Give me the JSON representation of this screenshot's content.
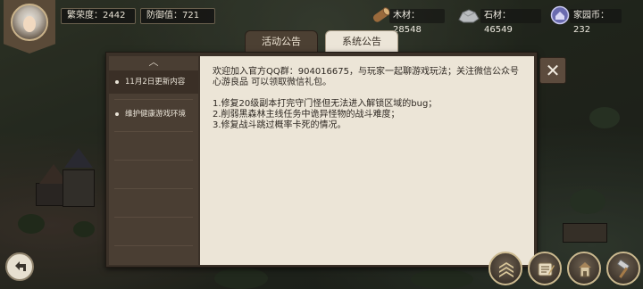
{
  "hud": {
    "prosperity": "繁荣度：2442",
    "defense": "防御值：721",
    "wood": "木材：28548",
    "stone": "石材：46549",
    "home_coin": "家园币：232"
  },
  "dialog": {
    "tabs": [
      {
        "label": "活动公告"
      },
      {
        "label": "系统公告"
      }
    ],
    "menu": [
      {
        "label": "11月2日更新内容"
      },
      {
        "label": "维护健康游戏环境"
      }
    ],
    "scroll_up_glyph": "︿",
    "close_glyph": "✕",
    "content": {
      "intro": "欢迎加入官方QQ群：904016675，与玩家一起聊游戏玩法；关注微信公众号 心游良品 可以领取微信礼包。",
      "lines": [
        "1.修复20级副本打完守门怪但无法进入解锁区域的bug；",
        "2.削弱黑森林主线任务中诡异怪物的战斗难度；",
        "3.修复战斗跳过概率卡死的情况。"
      ]
    }
  },
  "colors": {
    "panel": "#ece5d7",
    "frame": "#3b3128",
    "accent_gold": "#cbb98f"
  },
  "icons": {
    "wood": "log-icon",
    "stone": "stone-icon",
    "coin": "home-coin-icon",
    "back": "back-arrow-icon",
    "rank": "rank-chevrons-icon",
    "quest": "quest-scroll-icon",
    "build": "building-icon",
    "hammer": "hammer-icon"
  }
}
